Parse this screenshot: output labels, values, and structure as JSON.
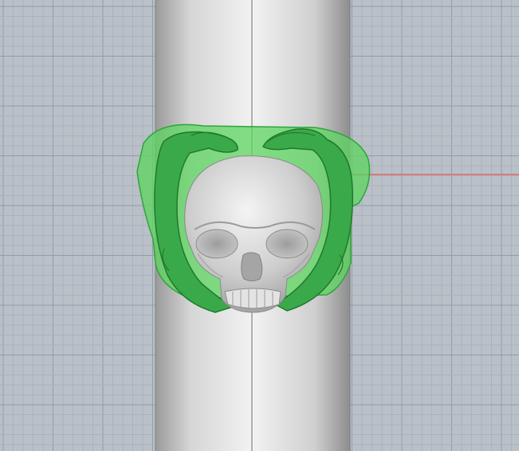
{
  "viewport": {
    "view": "front",
    "background_color": "#b9c0c8",
    "grid_color_minor": "#aab2bb",
    "grid_color_major": "#939ca6",
    "x_axis_color": "#e06666",
    "grid_visible": true
  },
  "scene": {
    "objects": [
      {
        "name": "ring-mandrel",
        "color": "#d2d2d2",
        "icon": "cylinder-icon"
      },
      {
        "name": "ring-shank-hands",
        "color": "#3fbf4a",
        "selected": true,
        "icon": "hand-sculpt-icon"
      },
      {
        "name": "skull",
        "color": "#cfcfcf",
        "icon": "skull-icon"
      }
    ]
  }
}
